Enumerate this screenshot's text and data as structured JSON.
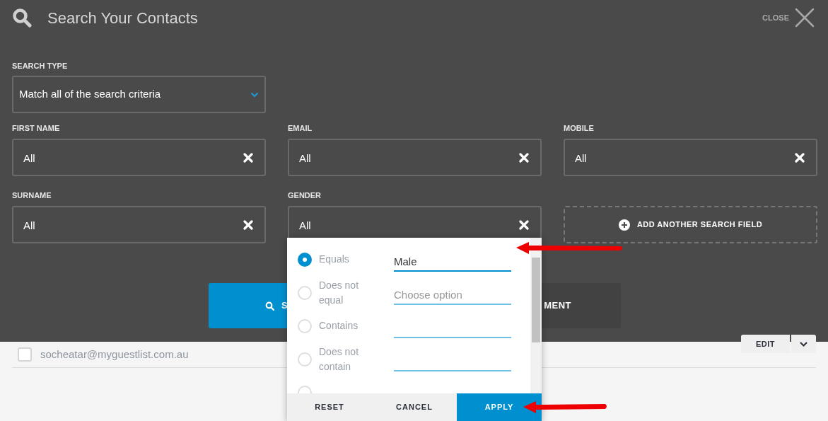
{
  "header": {
    "title": "Search Your Contacts",
    "close_label": "CLOSE"
  },
  "search_type": {
    "label": "SEARCH TYPE",
    "value": "Match all of the search criteria"
  },
  "fields": [
    {
      "kind": "clearable",
      "label": "FIRST NAME",
      "value": "All"
    },
    {
      "kind": "clearable",
      "label": "EMAIL",
      "value": "All"
    },
    {
      "kind": "clearable",
      "label": "MOBILE",
      "value": "All"
    },
    {
      "kind": "clearable",
      "label": "SURNAME",
      "value": "All"
    },
    {
      "kind": "clearable",
      "label": "GENDER",
      "value": "All"
    },
    {
      "kind": "add",
      "label": "ADD ANOTHER SEARCH FIELD"
    }
  ],
  "actions": [
    {
      "kind": "primary",
      "label": "S"
    },
    {
      "kind": "secondary",
      "label": "MENT"
    }
  ],
  "contact_row": {
    "checked": false,
    "email": "socheatar@myguestlist.com.au",
    "edit_label": "EDIT"
  },
  "gender_filter": {
    "options": [
      {
        "label": "Equals",
        "selected": true,
        "value": "Male"
      },
      {
        "label": "Does not equal",
        "selected": false,
        "placeholder": "Choose option"
      },
      {
        "label": "Contains",
        "selected": false
      },
      {
        "label": "Does not contain",
        "selected": false
      },
      {
        "selected": false
      }
    ],
    "buttons": [
      {
        "kind": "plain",
        "label": "RESET"
      },
      {
        "kind": "plain",
        "label": "CANCEL"
      },
      {
        "kind": "primary",
        "label": "APPLY"
      }
    ]
  }
}
